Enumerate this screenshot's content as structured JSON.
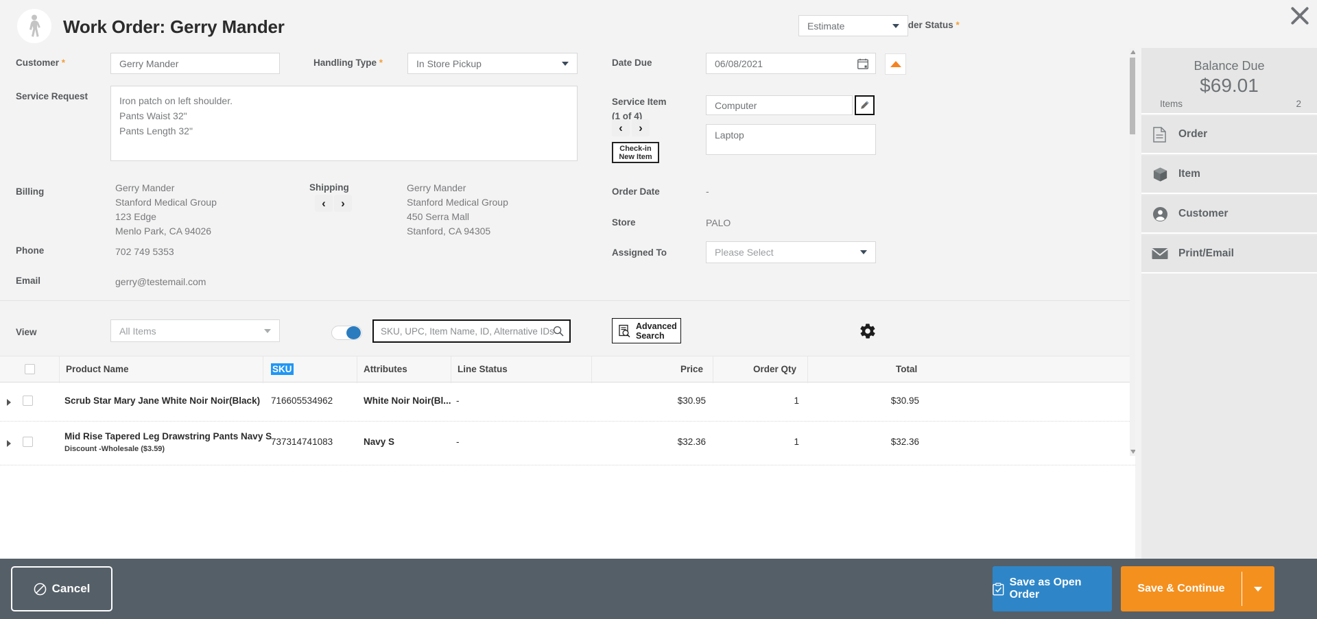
{
  "header": {
    "title": "Work Order: Gerry Mander",
    "avatar_icon": "walking-person-icon",
    "close_icon": "close-icon",
    "order_status_label": "Order Status",
    "order_status_required": "*",
    "order_status_value": "Estimate"
  },
  "form": {
    "customer_label": "Customer",
    "customer_required": "*",
    "customer_value": "Gerry Mander",
    "handling_label": "Handling Type",
    "handling_required": "*",
    "handling_value": "In Store Pickup",
    "service_request_label": "Service Request",
    "service_request_value": "Iron patch on left shoulder.\nPants Waist 32\"\nPants Length 32\"",
    "billing_label": "Billing",
    "billing_lines": [
      "Gerry Mander",
      "Stanford Medical Group",
      "123 Edge",
      "Menlo Park, CA 94026"
    ],
    "shipping_label": "Shipping",
    "shipping_lines": [
      "Gerry Mander",
      "Stanford Medical Group",
      "450 Serra Mall",
      "Stanford, CA 94305"
    ],
    "phone_label": "Phone",
    "phone_value": "702 749 5353",
    "email_label": "Email",
    "email_value": "gerry@testemail.com",
    "date_due_label": "Date Due",
    "date_due_value": "06/08/2021",
    "calendar_icon": "calendar-icon",
    "collapse_icon": "triangle-up-icon",
    "service_item_label": "Service Item",
    "service_item_counter": "(1 of 4)",
    "service_item_value": "Computer",
    "service_item_detail": "Laptop",
    "checkin_label": "Check-in\nNew Item",
    "edit_icon": "pencil-icon",
    "prev_icon": "chevron-left-icon",
    "next_icon": "chevron-right-icon",
    "order_date_label": "Order Date",
    "order_date_value": "-",
    "store_label": "Store",
    "store_value": "PALO",
    "assigned_label": "Assigned To",
    "assigned_placeholder": "Please Select"
  },
  "toolbar": {
    "view_label": "View",
    "view_value": "All Items",
    "toggle_state": "on",
    "search_placeholder": "SKU, UPC, Item Name, ID, Alternative IDs",
    "search_icon": "search-icon",
    "advanced_search_label": "Advanced\nSearch",
    "advanced_search_icon": "advanced-search-icon",
    "settings_icon": "gear-icon"
  },
  "grid": {
    "columns": [
      "Product Name",
      "SKU",
      "Attributes",
      "Line Status",
      "Price",
      "Order Qty",
      "Total"
    ],
    "selected_column": "SKU",
    "rows": [
      {
        "product_name": "Scrub Star Mary Jane White Noir Noir(Black)",
        "sub": "",
        "sku": "716605534962",
        "attributes": "White Noir Noir(Bl...",
        "line_status": "-",
        "price": "$30.95",
        "order_qty": "1",
        "total": "$30.95"
      },
      {
        "product_name": "Mid Rise Tapered Leg Drawstring Pants Navy S",
        "sub": "Discount -Wholesale ($3.59)",
        "sku": "737314741083",
        "attributes": "Navy S",
        "line_status": "-",
        "price": "$32.36",
        "order_qty": "1",
        "total": "$32.36"
      }
    ]
  },
  "sidebar": {
    "balance_label": "Balance Due",
    "balance_amount": "$69.01",
    "items_label": "Items",
    "items_count": "2",
    "items": [
      {
        "label": "Order",
        "icon": "document-icon"
      },
      {
        "label": "Item",
        "icon": "box-icon"
      },
      {
        "label": "Customer",
        "icon": "person-circle-icon"
      },
      {
        "label": "Print/Email",
        "icon": "envelope-icon"
      }
    ]
  },
  "bottom": {
    "cancel_label": "Cancel",
    "cancel_icon": "no-entry-icon",
    "save_open_label": "Save as Open Order",
    "save_open_icon": "clipboard-check-icon",
    "save_continue_label": "Save & Continue",
    "save_continue_caret_icon": "chevron-down-icon"
  },
  "colors": {
    "accent_orange": "#f4901e",
    "accent_blue": "#2e86c8",
    "bottom_bar": "#555f68",
    "required_star": "#f0a03c",
    "selection_blue": "#2196f3"
  }
}
